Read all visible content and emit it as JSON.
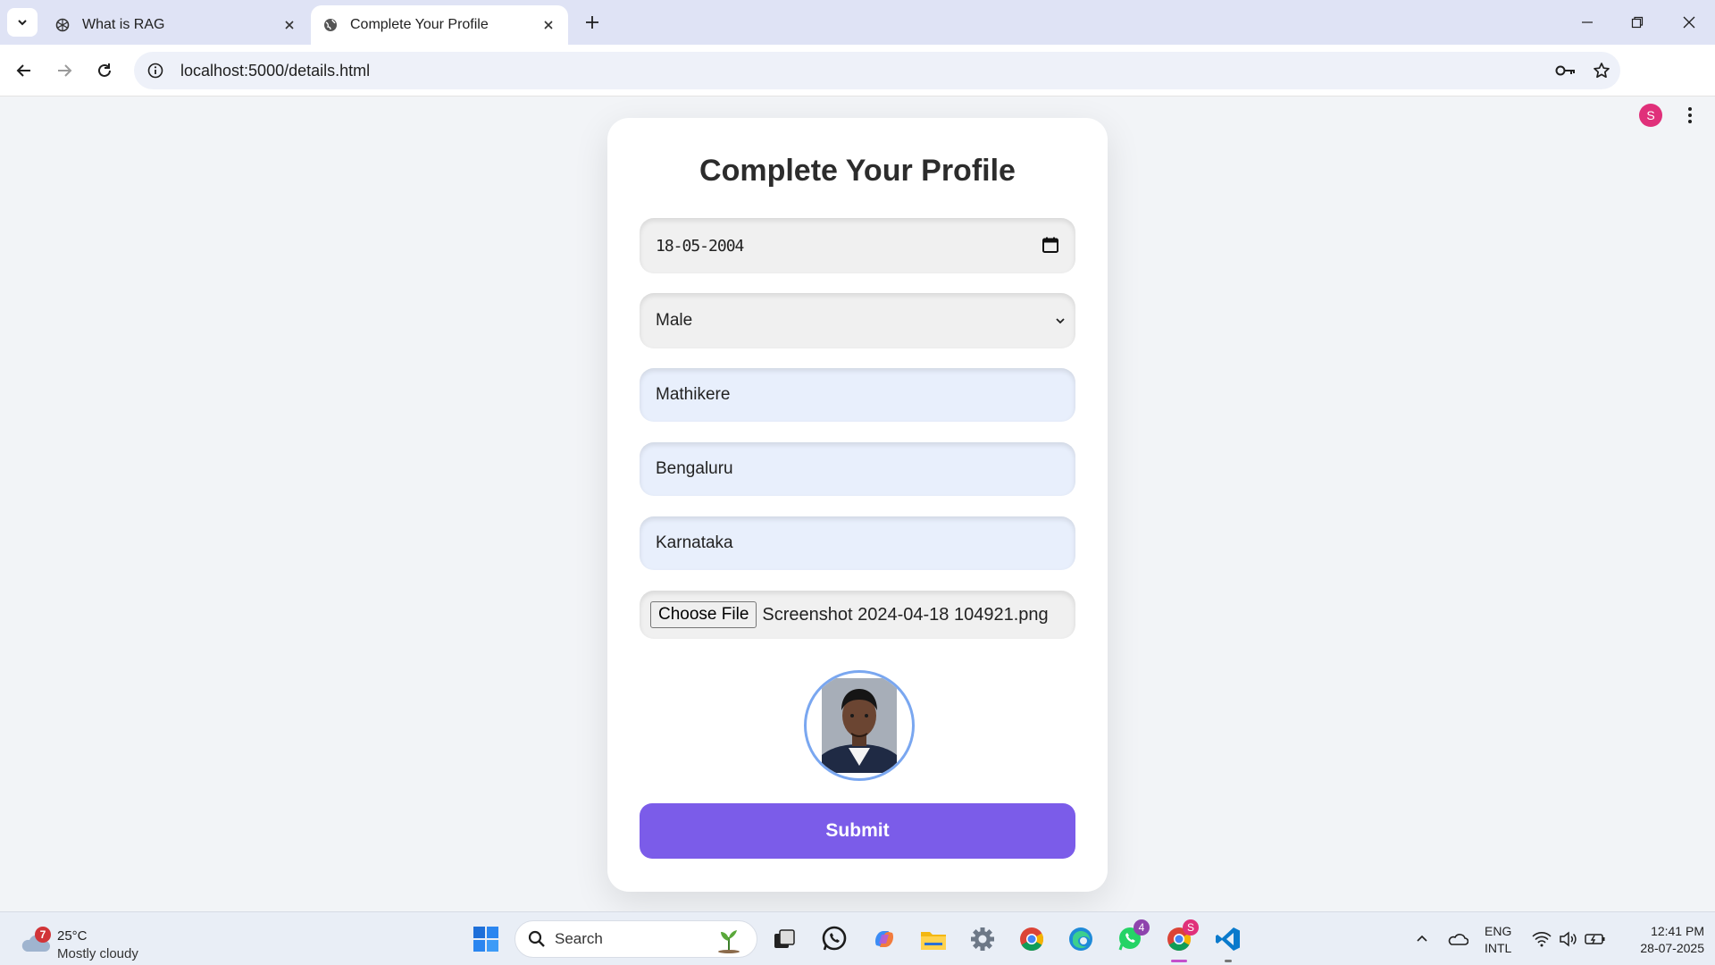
{
  "browser": {
    "tabs": [
      {
        "title": "What is RAG",
        "active": false,
        "icon": "openai-icon"
      },
      {
        "title": "Complete Your Profile",
        "active": true,
        "icon": "globe-icon"
      }
    ],
    "url": "localhost:5000/details.html",
    "profile_initial": "S"
  },
  "form": {
    "title": "Complete Your Profile",
    "dob": "18-05-2004",
    "gender": "Male",
    "area": "Mathikere",
    "city": "Bengaluru",
    "state": "Karnataka",
    "file_button": "Choose File",
    "file_name": "Screenshot 2024-04-18 104921.png",
    "submit_label": "Submit"
  },
  "colors": {
    "submit": "#7b5ce9",
    "avatar_ring": "#7aa7f0",
    "filled_input": "#e8effc"
  },
  "taskbar": {
    "weather_badge": "7",
    "weather_temp": "25°C",
    "weather_desc": "Mostly cloudy",
    "search_label": "Search",
    "whatsapp_badge": "4",
    "chrome_badge": "S",
    "lang_line1": "ENG",
    "lang_line2": "INTL",
    "time": "12:41 PM",
    "date": "28-07-2025"
  }
}
